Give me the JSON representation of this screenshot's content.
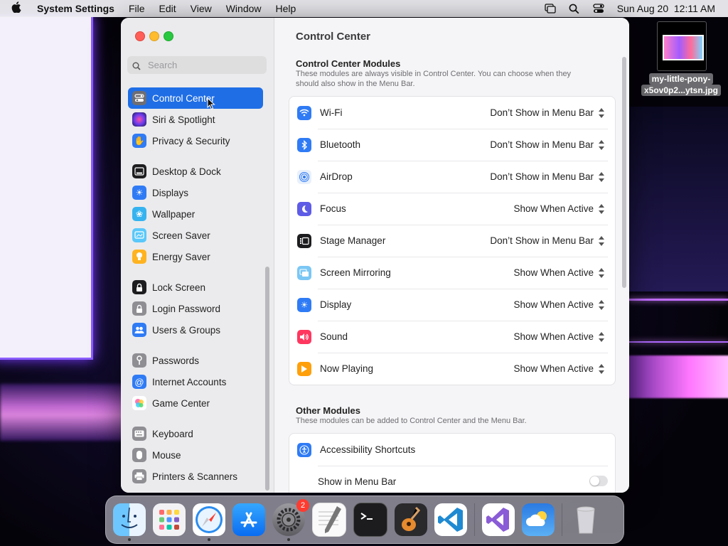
{
  "menubar": {
    "app_name": "System Settings",
    "items": [
      "File",
      "Edit",
      "View",
      "Window",
      "Help"
    ],
    "clock": "Sun Aug 20  12:11 AM"
  },
  "desktop": {
    "file_label_line1": "my-little-pony-",
    "file_label_line2": "x5ov0p2...ytsn.jpg"
  },
  "window": {
    "search_placeholder": "Search",
    "sidebar": [
      {
        "label": "Control Center",
        "icon": "control-center-icon",
        "color": "#6e6e73",
        "selected": true
      },
      {
        "label": "Siri & Spotlight",
        "icon": "siri-icon",
        "color": "#5a3ad8"
      },
      {
        "label": "Privacy & Security",
        "icon": "hand-icon",
        "color": "#2f7bf5"
      },
      {
        "label": "Desktop & Dock",
        "icon": "dock-icon",
        "color": "#1d1d1f"
      },
      {
        "label": "Displays",
        "icon": "sun-icon",
        "color": "#2f7bf5"
      },
      {
        "label": "Wallpaper",
        "icon": "flower-icon",
        "color": "#35b3f0"
      },
      {
        "label": "Screen Saver",
        "icon": "screensaver-icon",
        "color": "#5ac8fa"
      },
      {
        "label": "Energy Saver",
        "icon": "bulb-icon",
        "color": "#ffb320"
      },
      {
        "label": "Lock Screen",
        "icon": "lock-icon",
        "color": "#1d1d1f"
      },
      {
        "label": "Login Password",
        "icon": "lock-gray-icon",
        "color": "#8e8e93"
      },
      {
        "label": "Users & Groups",
        "icon": "users-icon",
        "color": "#2f7bf5"
      },
      {
        "label": "Passwords",
        "icon": "key-icon",
        "color": "#8e8e93"
      },
      {
        "label": "Internet Accounts",
        "icon": "at-icon",
        "color": "#2f7bf5"
      },
      {
        "label": "Game Center",
        "icon": "game-center-icon",
        "color": "#ffffff"
      },
      {
        "label": "Keyboard",
        "icon": "keyboard-icon",
        "color": "#8e8e93"
      },
      {
        "label": "Mouse",
        "icon": "mouse-icon",
        "color": "#8e8e93"
      },
      {
        "label": "Printers & Scanners",
        "icon": "printer-icon",
        "color": "#8e8e93"
      }
    ],
    "title": "Control Center",
    "modules_title": "Control Center Modules",
    "modules_desc": "These modules are always visible in Control Center. You can choose when they should also show in the Menu Bar.",
    "modules": [
      {
        "label": "Wi-Fi",
        "value": "Don’t Show in Menu Bar",
        "icon": "wifi-icon",
        "color": "#2f7bf5"
      },
      {
        "label": "Bluetooth",
        "value": "Don’t Show in Menu Bar",
        "icon": "bluetooth-icon",
        "color": "#2f7bf5"
      },
      {
        "label": "AirDrop",
        "value": "Don’t Show in Menu Bar",
        "icon": "airdrop-icon",
        "color": "#e8f0fb"
      },
      {
        "label": "Focus",
        "value": "Show When Active",
        "icon": "moon-icon",
        "color": "#5e5ce6"
      },
      {
        "label": "Stage Manager",
        "value": "Don’t Show in Menu Bar",
        "icon": "stage-manager-icon",
        "color": "#1d1d1f"
      },
      {
        "label": "Screen Mirroring",
        "value": "Show When Active",
        "icon": "mirroring-icon",
        "color": "#7ac7f5"
      },
      {
        "label": "Display",
        "value": "Show When Active",
        "icon": "sun-icon",
        "color": "#2f7bf5"
      },
      {
        "label": "Sound",
        "value": "Show When Active",
        "icon": "speaker-icon",
        "color": "#ff375f"
      },
      {
        "label": "Now Playing",
        "value": "Show When Active",
        "icon": "play-icon",
        "color": "#ff9f0a"
      }
    ],
    "other_title": "Other Modules",
    "other_desc": "These modules can be added to Control Center and the Menu Bar.",
    "other": [
      {
        "label": "Accessibility Shortcuts",
        "icon": "accessibility-icon",
        "color": "#2f7bf5"
      }
    ],
    "show_in_menu_bar": "Show in Menu Bar"
  },
  "dock": {
    "apps": [
      {
        "name": "finder-icon",
        "running": true
      },
      {
        "name": "launchpad-icon",
        "running": false
      },
      {
        "name": "safari-icon",
        "running": true
      },
      {
        "name": "app-store-icon",
        "running": false
      },
      {
        "name": "system-settings-icon",
        "running": true,
        "badge": "2"
      },
      {
        "name": "textedit-icon",
        "running": false
      },
      {
        "name": "terminal-icon",
        "running": false
      },
      {
        "name": "garageband-icon",
        "running": false
      },
      {
        "name": "vscode-icon",
        "running": false
      },
      {
        "name": "visual-studio-icon",
        "running": false
      },
      {
        "name": "weather-icon",
        "running": false
      },
      {
        "name": "trash-icon",
        "running": false
      }
    ]
  }
}
